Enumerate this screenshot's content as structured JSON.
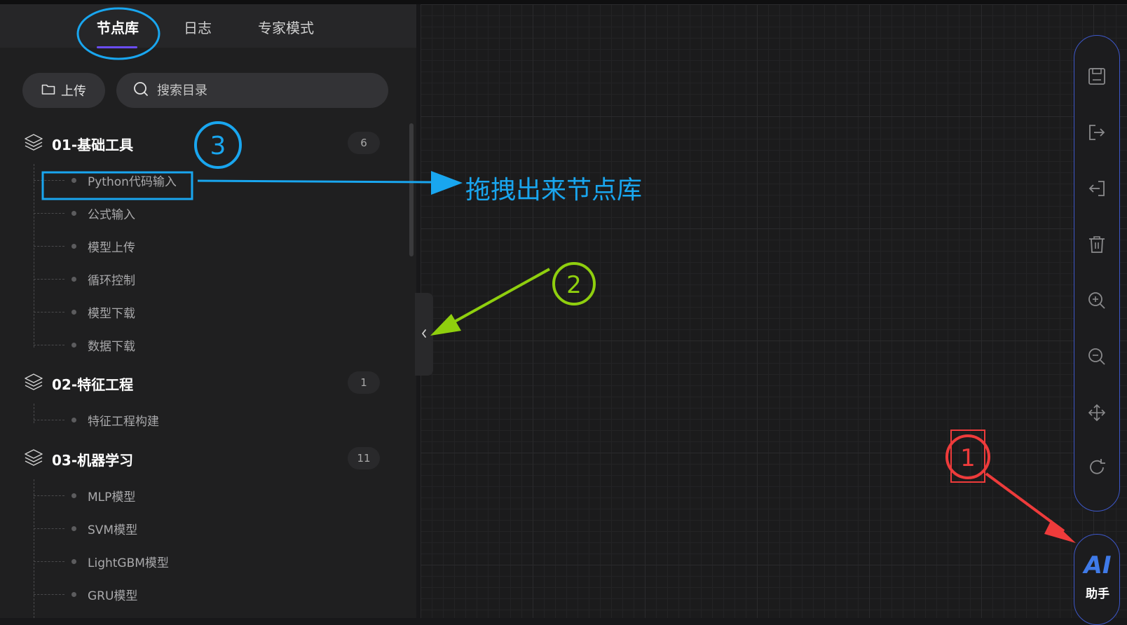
{
  "tabs": [
    {
      "label": "节点库",
      "active": true
    },
    {
      "label": "日志",
      "active": false
    },
    {
      "label": "专家模式",
      "active": false
    }
  ],
  "upload_label": "上传",
  "search": {
    "placeholder": "搜索目录"
  },
  "groups": [
    {
      "title": "01-基础工具",
      "count": "6",
      "items": [
        "Python代码输入",
        "公式输入",
        "模型上传",
        "循环控制",
        "模型下载",
        "数据下载"
      ]
    },
    {
      "title": "02-特征工程",
      "count": "1",
      "items": [
        "特征工程构建"
      ]
    },
    {
      "title": "03-机器学习",
      "count": "11",
      "items": [
        "MLP模型",
        "SVM模型",
        "LightGBM模型",
        "GRU模型"
      ]
    }
  ],
  "toolbar_icons": [
    "save-icon",
    "export-icon",
    "import-icon",
    "delete-icon",
    "zoom-in-icon",
    "zoom-out-icon",
    "fit-view-icon",
    "refresh-icon"
  ],
  "ai_assistant": {
    "logo": "AI",
    "label": "助手"
  },
  "annotations": {
    "marker_1": "1",
    "marker_2": "2",
    "marker_3": "3",
    "drag_hint": "拖拽出来节点库"
  },
  "colors": {
    "accent": "#6a4df5",
    "toolbar_border": "#3d57c9",
    "annotation_blue": "#19a6ef",
    "annotation_green": "#8fcf0e",
    "annotation_red": "#ee3b3b"
  }
}
